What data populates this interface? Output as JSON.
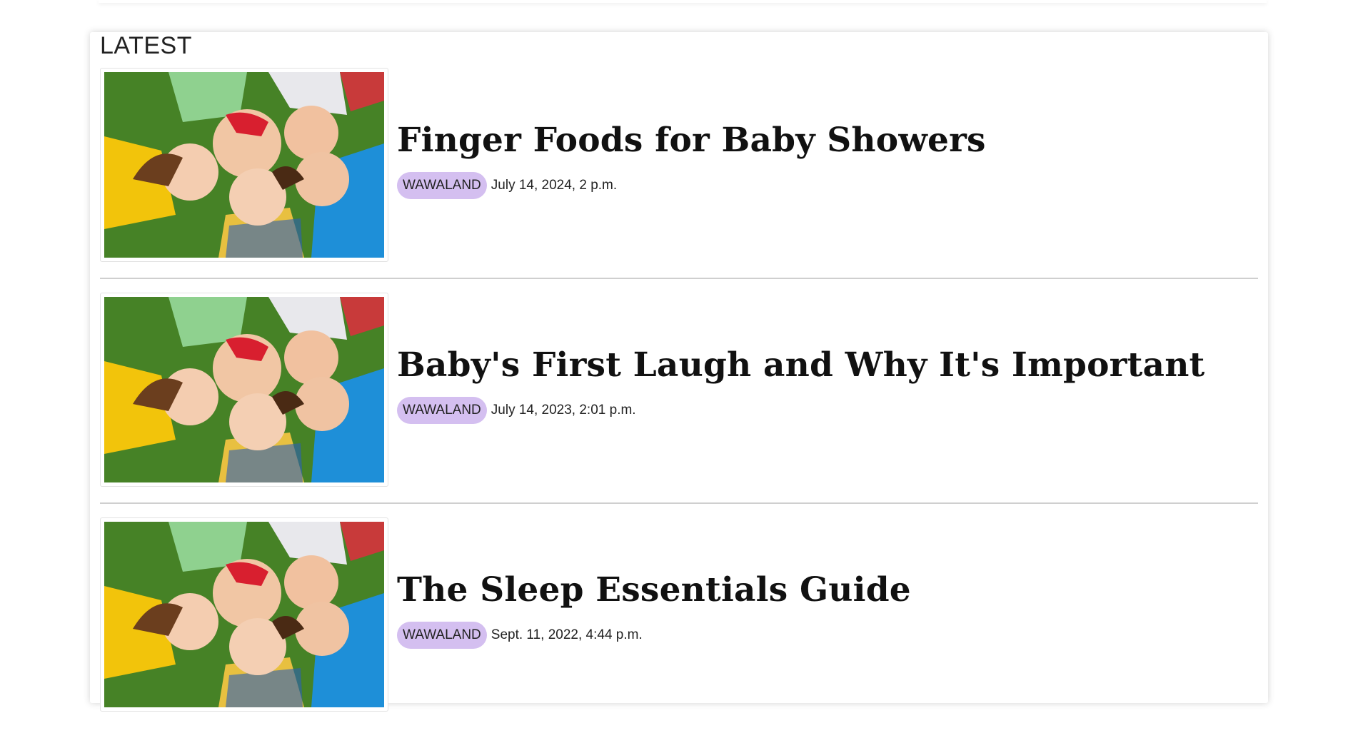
{
  "section": {
    "title": "LATEST"
  },
  "posts": [
    {
      "title": "Finger Foods for Baby Showers",
      "category": "WAWALAND",
      "date": "July 14, 2024, 2 p.m."
    },
    {
      "title": "Baby's First Laugh and Why It's Important",
      "category": "WAWALAND",
      "date": "July 14, 2023, 2:01 p.m."
    },
    {
      "title": "The Sleep Essentials Guide",
      "category": "WAWALAND",
      "date": "Sept. 11, 2022, 4:44 p.m."
    }
  ],
  "colors": {
    "badge": "#d4bff0",
    "divider": "#cfcfcf"
  }
}
